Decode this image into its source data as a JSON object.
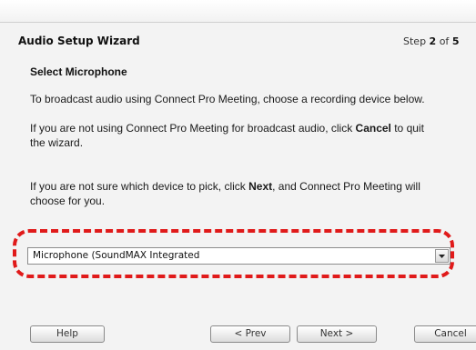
{
  "wizard": {
    "title": "Audio Setup Wizard",
    "step_prefix": "Step ",
    "step_current": "2",
    "step_mid": " of ",
    "step_total": "5"
  },
  "content": {
    "section_title": "Select Microphone",
    "para1": "To broadcast audio using Connect Pro Meeting, choose a recording device below.",
    "para2_prefix": "If you are not using Connect Pro Meeting for broadcast audio, click ",
    "para2_bold": "Cancel",
    "para2_suffix": " to quit the wizard.",
    "para3_prefix": "If you are not sure which device to pick, click ",
    "para3_bold": "Next",
    "para3_suffix": ", and Connect Pro Meeting will choose for you."
  },
  "microphone_select": {
    "selected": "Microphone (SoundMAX Integrated",
    "arrow_icon": "chevron-down-icon"
  },
  "highlight": {
    "color": "#e01a1a"
  },
  "buttons": {
    "help": "Help",
    "prev": "< Prev",
    "next": "Next >",
    "cancel": "Cancel"
  }
}
